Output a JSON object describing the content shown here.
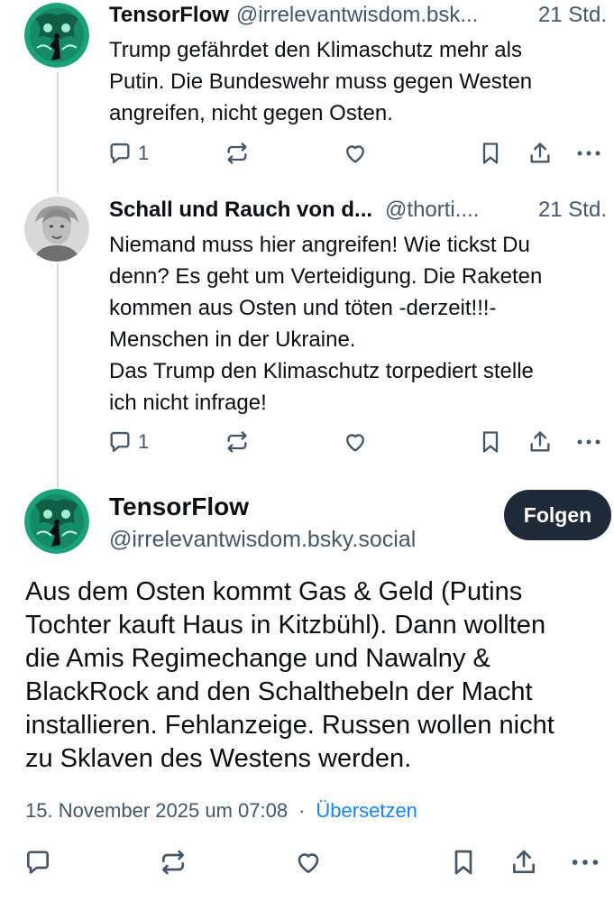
{
  "posts": [
    {
      "author_name": "TensorFlow",
      "handle": "@irrelevantwisdom.bsk...",
      "time": "21 Std.",
      "text": "Trump gefährdet den Klimaschutz mehr als\nPutin. Die Bundeswehr muss gegen Westen\nangreifen, nicht gegen Osten.",
      "reply_count": "1",
      "avatar_icon": "tensorflow-avatar"
    },
    {
      "author_name": "Schall und Rauch von d...",
      "handle": "@thorti....",
      "time": "21 Std.",
      "text": "Niemand muss hier angreifen! Wie tickst Du\ndenn? Es geht um Verteidigung. Die Raketen\nkommen aus Osten und töten -derzeit!!!-\nMenschen in der Ukraine.\nDas Trump den Klimaschutz torpediert stelle\nich nicht infrage!",
      "reply_count": "1",
      "avatar_icon": "person-avatar"
    }
  ],
  "main_post": {
    "author_name": "TensorFlow",
    "handle": "@irrelevantwisdom.bsky.social",
    "follow_label": "Folgen",
    "text": "Aus dem Osten kommt Gas & Geld (Putins\nTochter kauft Haus in Kitzbühl). Dann wollten\ndie Amis Regimechange und Nawalny &\nBlackRock and den Schalthebeln der Macht\ninstallieren. Fehlanzeige. Russen wollen nicht\nzu Sklaven des Westens werden.",
    "timestamp": "15. November 2025 um 07:08",
    "separator": "·",
    "translate_label": "Übersetzen"
  },
  "icons": [
    "reply-icon",
    "repost-icon",
    "like-icon",
    "bookmark-icon",
    "share-icon",
    "more-icon"
  ],
  "colors": {
    "text": "#0b0f14",
    "muted": "#42576c",
    "link": "#1083fe",
    "button_bg": "#1e2a38",
    "thread_line": "#d4dbe2",
    "avatar_green": "#1aa37a"
  }
}
